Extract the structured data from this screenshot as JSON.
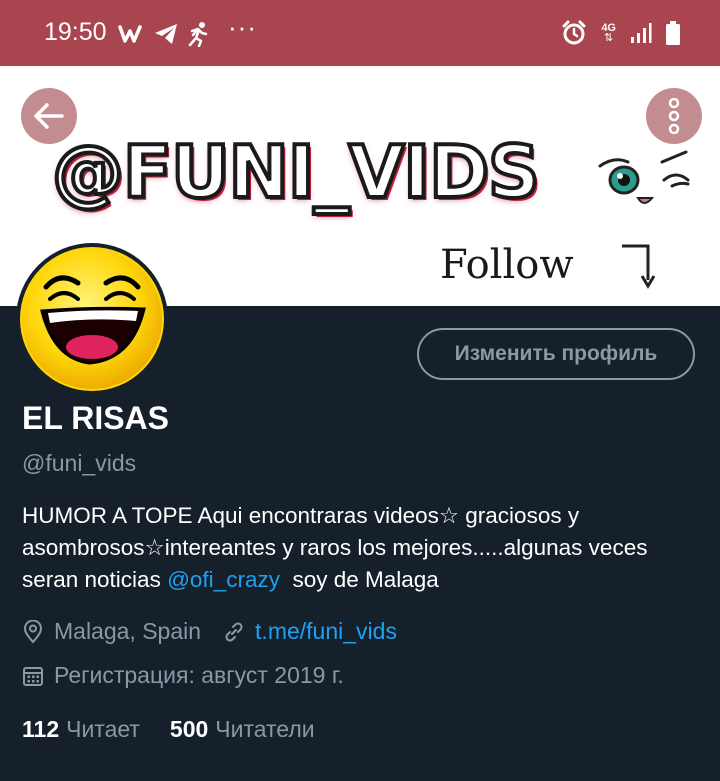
{
  "status_bar": {
    "time": "19:50",
    "more": "···",
    "network": "4G",
    "left_icons": [
      "w-app-icon",
      "telegram-icon",
      "running-icon"
    ],
    "right_icons": [
      "alarm-icon",
      "network-icon",
      "signal-icon",
      "battery-icon"
    ],
    "color": "#a8454f"
  },
  "banner": {
    "handle_text": "@FUNI_VIDS",
    "follow_text": "Follow",
    "background": "#ffffff"
  },
  "header": {
    "back_icon": "arrow-left-icon",
    "more_icon": "more-vertical-icon"
  },
  "profile": {
    "edit_button": "Изменить профиль",
    "display_name": "EL RISAS",
    "username": "@funi_vids",
    "bio_part1": "HUMOR A TOPE Aqui encontraras videos☆ graciosos y asombrosos☆intereantes y raros los mejores.....algunas veces seran noticias ",
    "bio_mention": "@ofi_crazy",
    "bio_part2": "  soy de Malaga",
    "location": "Malaga, Spain",
    "link": "t.me/funi_vids",
    "joined": "Регистрация: август 2019 г.",
    "following_count": "112",
    "following_label": "Читает",
    "followers_count": "500",
    "followers_label": "Читатели"
  },
  "colors": {
    "background": "#15202b",
    "accent": "#1da1f2",
    "secondary_text": "#8899a6"
  }
}
